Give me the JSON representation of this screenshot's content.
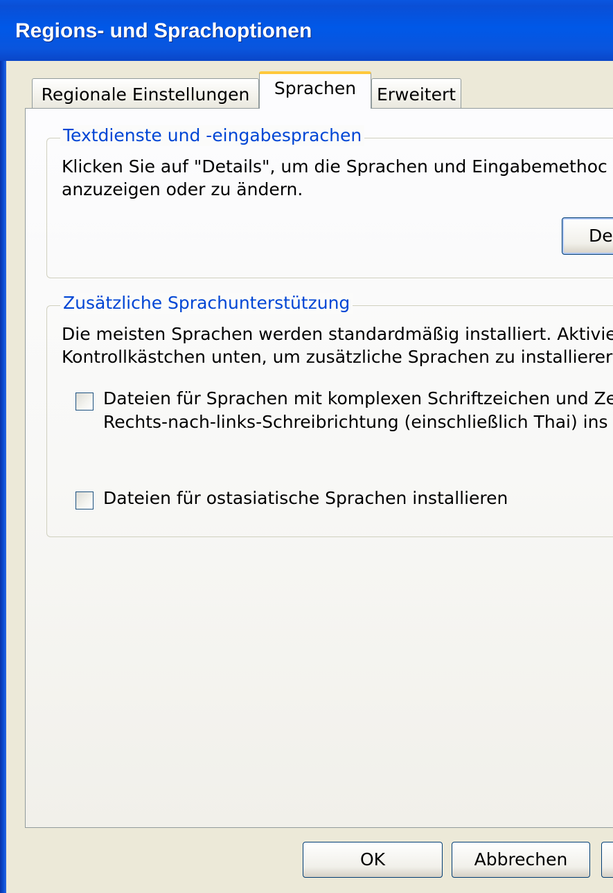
{
  "window": {
    "title": "Regions- und Sprachoptionen"
  },
  "tabs": [
    {
      "label": "Regionale Einstellungen",
      "active": false
    },
    {
      "label": "Sprachen",
      "active": true
    },
    {
      "label": "Erweitert",
      "active": false
    }
  ],
  "text_services": {
    "group_label": "Textdienste und -eingabesprachen",
    "description_line1": "Klicken Sie auf \"Details\", um die Sprachen und Eingabemethoc",
    "description_line2": "anzuzeigen oder zu ändern.",
    "details_button_label": "De"
  },
  "additional_support": {
    "group_label": "Zusätzliche Sprachunterstützung",
    "description_line1": "Die meisten Sprachen werden standardmäßig installiert. Aktivier",
    "description_line2": "Kontrollkästchen unten, um zusätzliche Sprachen zu installierer",
    "complex_script_checkbox": {
      "checked": false,
      "label_line1": "Dateien für Sprachen mit komplexen Schriftzeichen und Ze",
      "label_line2": "Rechts-nach-links-Schreibrichtung (einschließlich Thai) ins"
    },
    "east_asian_checkbox": {
      "checked": false,
      "label": "Dateien für ostasiatische Sprachen installieren"
    }
  },
  "dialog_buttons": {
    "ok_label": "OK",
    "cancel_label": "Abbrechen"
  },
  "colors": {
    "titlebar": "#0058e8",
    "group_label": "#0046d5",
    "active_tab_highlight": "#ffc83c",
    "dialog_background": "#ece9d8"
  }
}
